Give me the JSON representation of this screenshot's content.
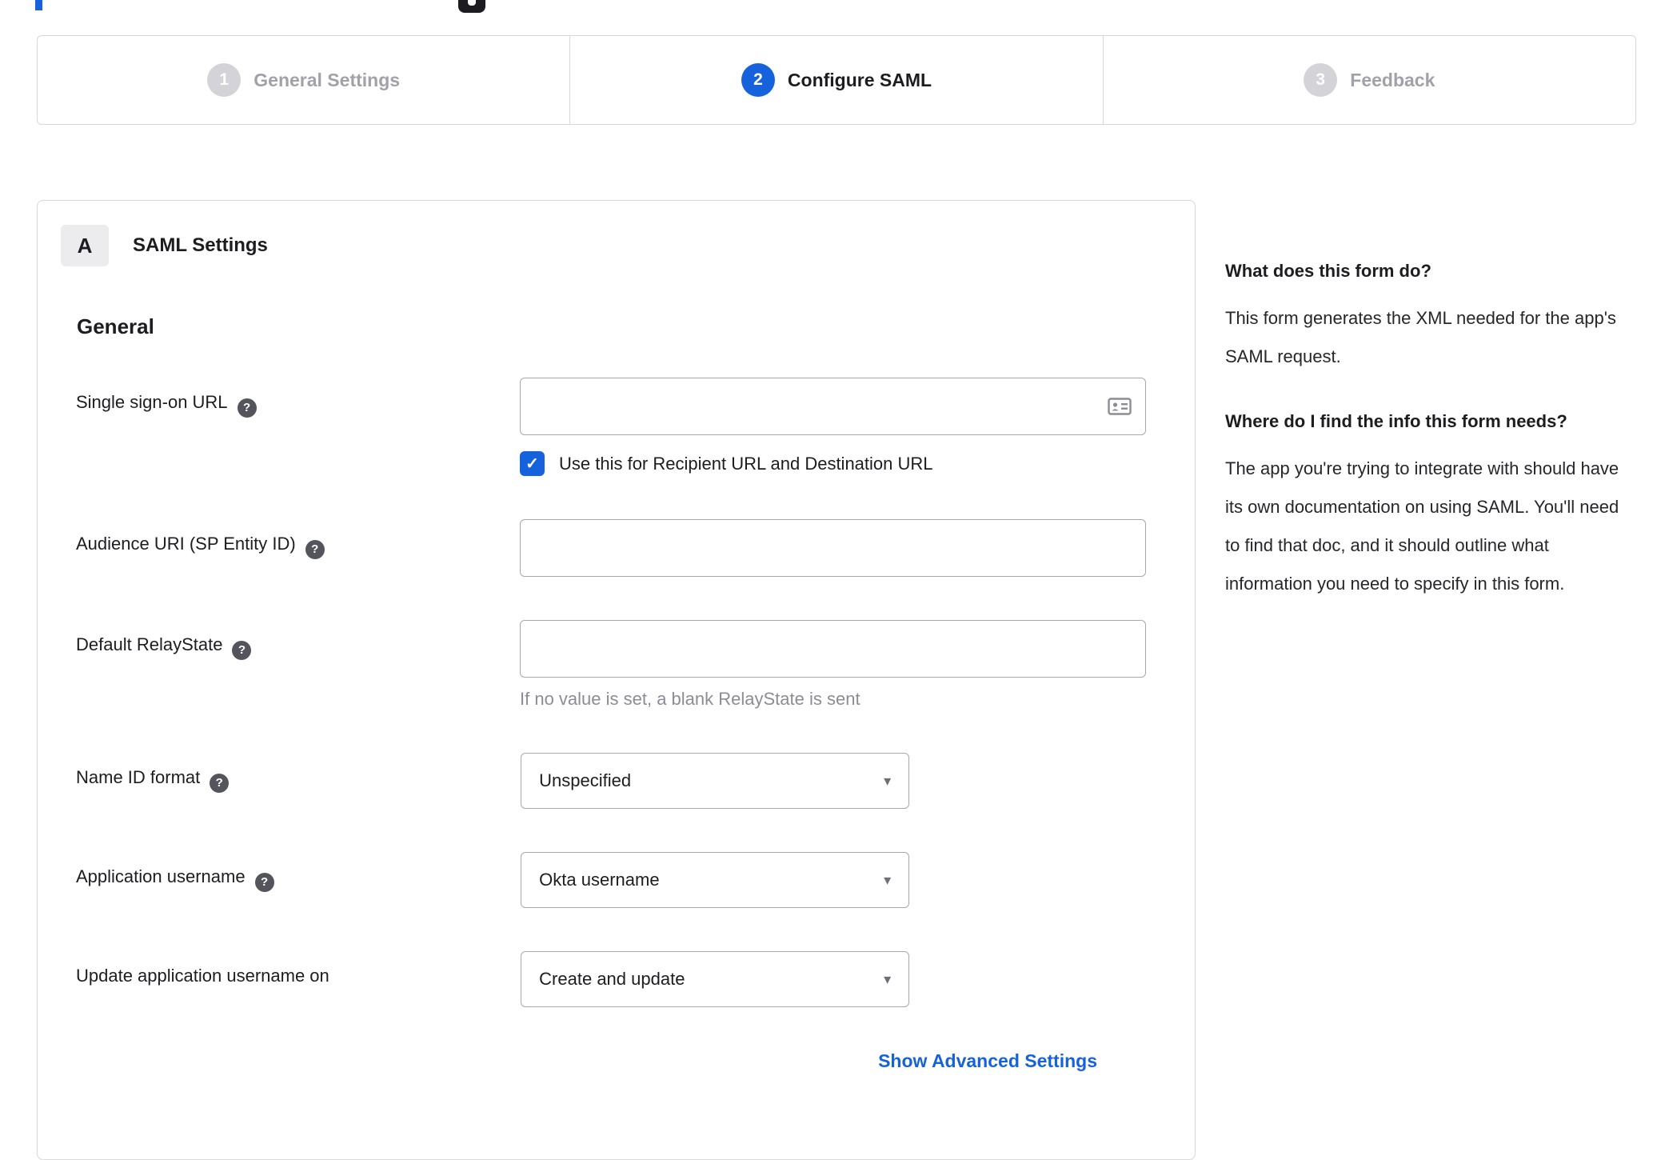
{
  "colors": {
    "accent": "#1662dd",
    "inactive_step": "#d4d4d8",
    "border": "#d7d7dc",
    "text": "#1d1d21",
    "muted": "#8c8c96"
  },
  "icons": {
    "help": "?",
    "check": "✓",
    "caret": "▾",
    "contact_card": "contact-card"
  },
  "stepper": {
    "steps": [
      {
        "number": "1",
        "label": "General Settings",
        "state": "inactive"
      },
      {
        "number": "2",
        "label": "Configure SAML",
        "state": "active"
      },
      {
        "number": "3",
        "label": "Feedback",
        "state": "inactive"
      }
    ]
  },
  "panel": {
    "badge": "A",
    "title": "SAML Settings",
    "section": "General",
    "fields": {
      "sso": {
        "label": "Single sign-on URL",
        "value": "",
        "checkbox_checked": true,
        "checkbox_label": "Use this for Recipient URL and Destination URL"
      },
      "audience": {
        "label": "Audience URI (SP Entity ID)",
        "value": ""
      },
      "relay": {
        "label": "Default RelayState",
        "value": "",
        "helper": "If no value is set, a blank RelayState is sent"
      },
      "nameid": {
        "label": "Name ID format",
        "value": "Unspecified"
      },
      "appuser": {
        "label": "Application username",
        "value": "Okta username"
      },
      "update": {
        "label": "Update application username on",
        "value": "Create and update"
      }
    },
    "advanced_link": "Show Advanced Settings"
  },
  "help": {
    "q1": "What does this form do?",
    "a1": "This form generates the XML needed for the app's SAML request.",
    "q2": "Where do I find the info this form needs?",
    "a2": "The app you're trying to integrate with should have its own documentation on using SAML. You'll need to find that doc, and it should outline what information you need to specify in this form."
  }
}
